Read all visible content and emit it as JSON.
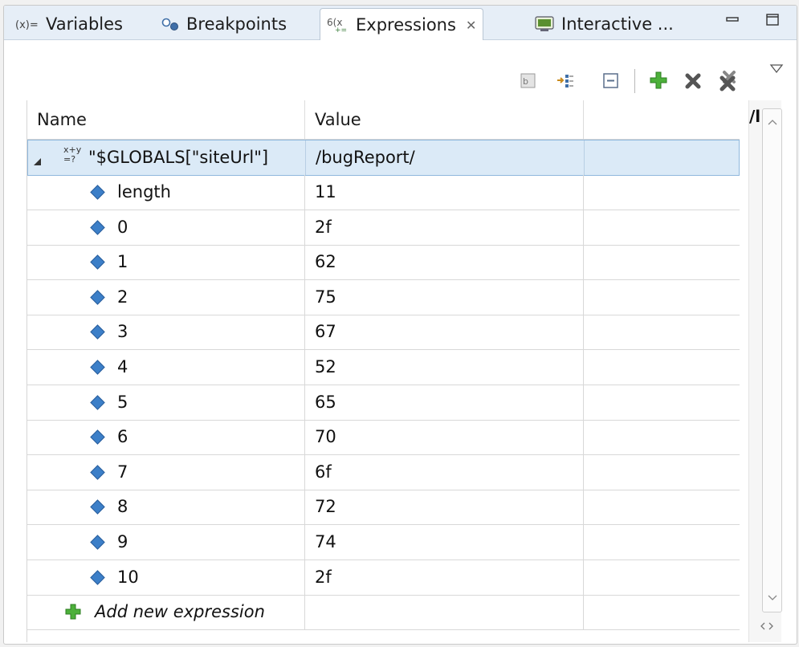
{
  "tabs": [
    {
      "label": "Variables",
      "icon": "variables-icon",
      "active": false
    },
    {
      "label": "Breakpoints",
      "icon": "breakpoints-icon",
      "active": false
    },
    {
      "label": "Expressions",
      "icon": "expressions-icon",
      "active": true
    },
    {
      "label": "Interactive ...",
      "icon": "interactive-console-icon",
      "active": false
    }
  ],
  "window_controls": {
    "minimize": "▭",
    "maximize": "▢"
  },
  "toolbar": {
    "icons": [
      "show-type-names-icon",
      "collapse-expand-icon",
      "collapse-all-icon",
      "add-watch-expression-icon",
      "remove-expression-icon",
      "remove-all-expressions-icon"
    ],
    "view_menu_icon": "view-menu-icon"
  },
  "table": {
    "columns": [
      "Name",
      "Value",
      ""
    ],
    "root": {
      "name": "\"$GLOBALS[\"siteUrl\"]",
      "value": "/bugReport/",
      "icon": "watch-expression-icon"
    },
    "children": [
      {
        "name": "length",
        "value": "11"
      },
      {
        "name": "0",
        "value": "2f"
      },
      {
        "name": "1",
        "value": "62"
      },
      {
        "name": "2",
        "value": "75"
      },
      {
        "name": "3",
        "value": "67"
      },
      {
        "name": "4",
        "value": "52"
      },
      {
        "name": "5",
        "value": "65"
      },
      {
        "name": "6",
        "value": "70"
      },
      {
        "name": "7",
        "value": "6f"
      },
      {
        "name": "8",
        "value": "72"
      },
      {
        "name": "9",
        "value": "74"
      },
      {
        "name": "10",
        "value": "2f"
      }
    ],
    "add_new_label": "Add new expression"
  },
  "detail_pane_text": "/l",
  "colors": {
    "tab_bar_bg": "#e6eef7",
    "selection_bg": "#dbeaf7",
    "diamond": "#3c7fc8",
    "add_green": "#3aa62c"
  }
}
